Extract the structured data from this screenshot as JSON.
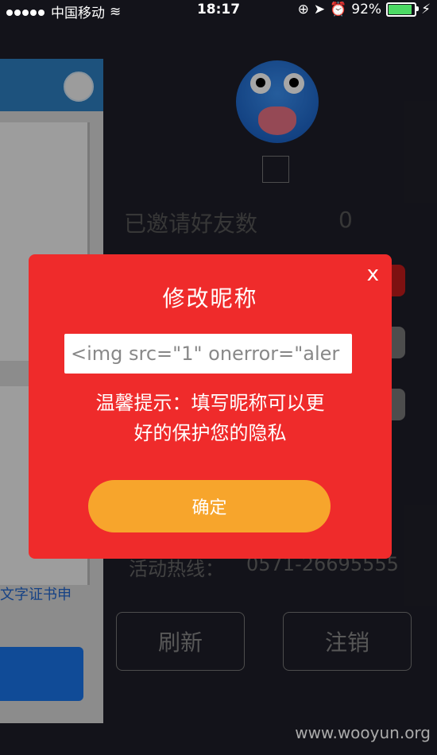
{
  "status_bar": {
    "carrier": "中国移动",
    "time": "18:17",
    "battery_percent": "92%",
    "battery_level": 0.92
  },
  "profile": {
    "invited_friends_label": "已邀请好友数",
    "invited_friends_count": "0",
    "hotline_label": "活动热线：",
    "hotline_number": "0571-26695555"
  },
  "actions": {
    "refresh_label": "刷新",
    "logout_label": "注销"
  },
  "background_card": {
    "doc_text": "文字证书申"
  },
  "modal": {
    "title": "修改昵称",
    "close_label": "x",
    "nickname_value": "<img src=\"1\" onerror=\"aler",
    "hint_line1": "温馨提示：填写昵称可以更",
    "hint_line2": "好的保护您的隐私",
    "confirm_label": "确定"
  },
  "watermark": "www.wooyun.org",
  "colors": {
    "modal_bg": "#ef2b2b",
    "confirm_bg": "#f7a52c",
    "app_bg": "#1e1e28"
  }
}
